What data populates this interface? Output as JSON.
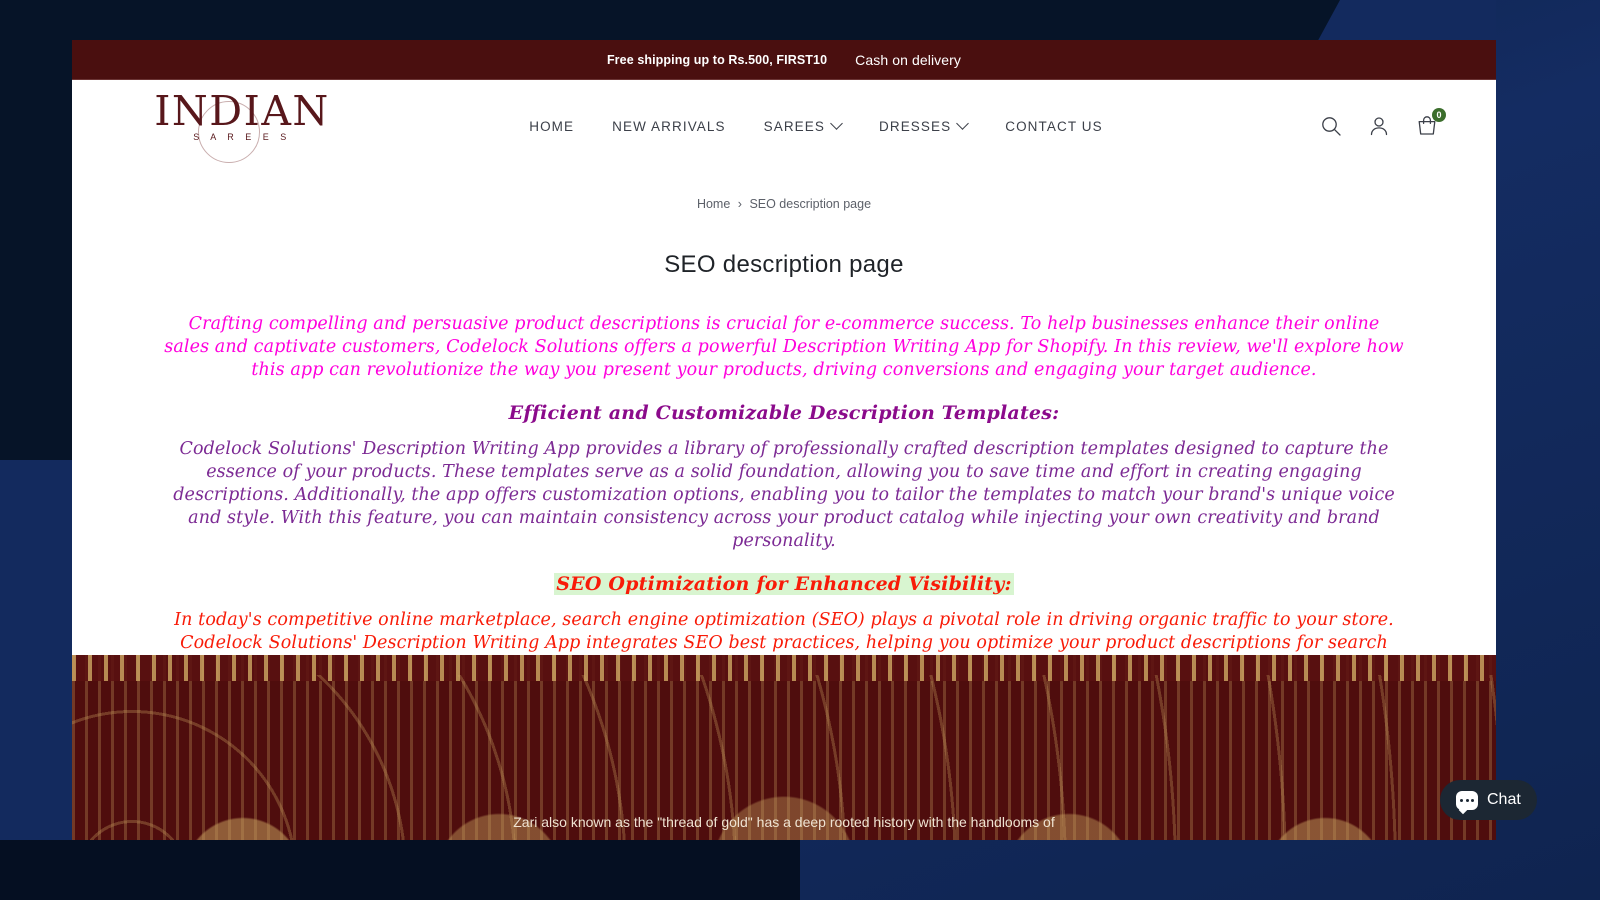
{
  "announcement": {
    "promo": "Free shipping up to Rs.500, FIRST10",
    "payment": "Cash on delivery"
  },
  "header": {
    "logo": {
      "word": "INDIAN",
      "sub": "S A R E E S"
    },
    "nav": [
      {
        "label": "HOME",
        "has_dropdown": false
      },
      {
        "label": "NEW ARRIVALS",
        "has_dropdown": false
      },
      {
        "label": "SAREES",
        "has_dropdown": true
      },
      {
        "label": "DRESSES",
        "has_dropdown": true
      },
      {
        "label": "CONTACT US",
        "has_dropdown": false
      }
    ],
    "icons": {
      "search": "search-icon",
      "account": "account-icon",
      "cart": "cart-icon"
    },
    "cart_count": "0",
    "cart_badge_color": "#3c6e2c"
  },
  "breadcrumb": {
    "home": "Home",
    "separator": "›",
    "current": "SEO description page"
  },
  "page": {
    "title": "SEO description page"
  },
  "content": {
    "intro": "Crafting compelling and persuasive product descriptions is crucial for e-commerce success. To help businesses enhance their online sales and captivate customers, Codelock Solutions offers a powerful Description Writing App for Shopify. In this review, we'll explore how this app can revolutionize the way you present your products, driving conversions and engaging your target audience.",
    "section1_heading": "Efficient and Customizable Description Templates:",
    "section1_body": "Codelock Solutions' Description Writing App provides a library of professionally crafted description templates designed to capture the essence of your products. These templates serve as a solid foundation, allowing you to save time and effort in creating engaging descriptions. Additionally, the app offers customization options, enabling you to tailor the templates to match your brand's unique voice and style. With this feature, you can maintain consistency across your product catalog while injecting your own creativity and brand personality.",
    "section2_heading": "SEO Optimization for Enhanced Visibility:",
    "section2_body": "In today's competitive online marketplace, search engine optimization (SEO) plays a pivotal role in driving organic traffic to your store. Codelock Solutions' Description Writing App integrates SEO best practices, helping you optimize your product descriptions for search engines. By including relevant keywords and meta tags, you can increase the visibility of your products and improve their rankings in search results.",
    "colors": {
      "intro": "#ff00dd",
      "section1_heading": "#8b0a8b",
      "section1_body": "#7c2a94",
      "section2_heading": "#f81b08",
      "section2_heading_highlight": "#d8f5d0",
      "section2_body": "#f81b08"
    }
  },
  "footer": {
    "text": "Zari also known as the \"thread of gold\" has a deep rooted history with the handlooms of",
    "background_color": "#4f0d0d"
  },
  "chat": {
    "label": "Chat",
    "icon": "chat-bubble-icon"
  }
}
